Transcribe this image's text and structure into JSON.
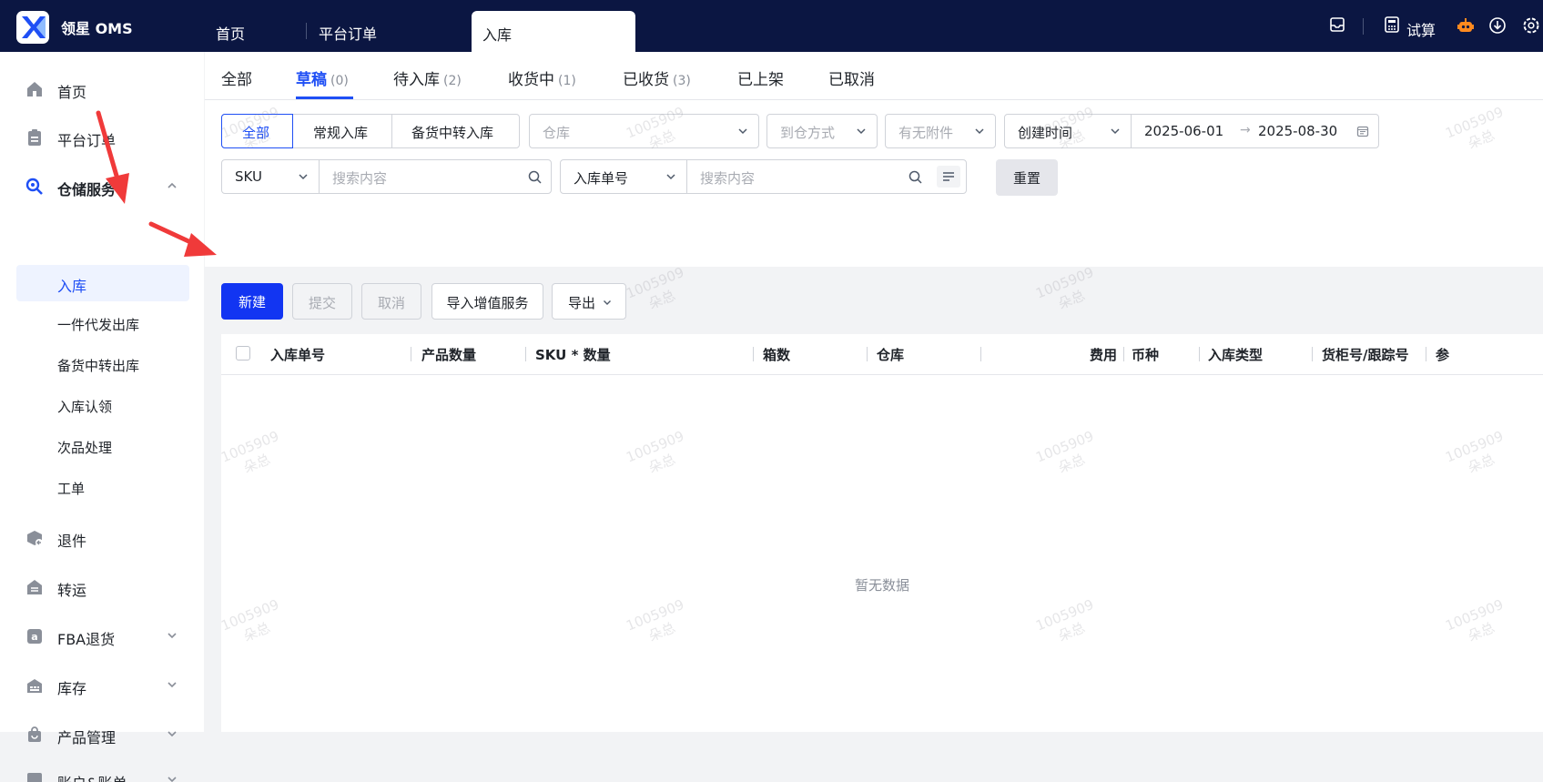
{
  "topbar": {
    "brand": "领星 OMS",
    "tabs": [
      "首页",
      "平台订单"
    ],
    "active_tab": "入库",
    "right_label": "试算"
  },
  "sidebar": {
    "home": "首页",
    "orders": "平台订单",
    "warehouse": "仓储服务",
    "sub": [
      "入库",
      "一件代发出库",
      "备货中转出库",
      "入库认领",
      "次品处理",
      "工单"
    ],
    "returns": "退件",
    "transfer": "转运",
    "fba": "FBA退货",
    "inventory": "库存",
    "products": "产品管理",
    "account": "账户&账单"
  },
  "status_tabs": [
    {
      "label": "全部",
      "count": ""
    },
    {
      "label": "草稿",
      "count": "(0)"
    },
    {
      "label": "待入库",
      "count": "(2)"
    },
    {
      "label": "收货中",
      "count": "(1)"
    },
    {
      "label": "已收货",
      "count": "(3)"
    },
    {
      "label": "已上架",
      "count": ""
    },
    {
      "label": "已取消",
      "count": ""
    }
  ],
  "filters": {
    "type_segments": [
      "全部",
      "常规入库",
      "备货中转入库"
    ],
    "warehouse_placeholder": "仓库",
    "arrival_placeholder": "到仓方式",
    "attachment_placeholder": "有无附件",
    "date_field": "创建时间",
    "date_start": "2025-06-01",
    "date_end": "2025-08-30",
    "sku_field": "SKU",
    "search_placeholder": "搜索内容",
    "order_field": "入库单号",
    "search_placeholder2": "搜索内容",
    "reset": "重置"
  },
  "actions": {
    "new": "新建",
    "submit": "提交",
    "cancel": "取消",
    "import": "导入增值服务",
    "export": "导出"
  },
  "table": {
    "columns": [
      "入库单号",
      "产品数量",
      "SKU * 数量",
      "箱数",
      "仓库",
      "费用",
      "币种",
      "入库类型",
      "货柜号/跟踪号",
      "参"
    ],
    "empty": "暂无数据"
  },
  "watermark": {
    "line1": "1005909",
    "line2": "朵总"
  },
  "colors": {
    "primary": "#1235f2",
    "topbar": "#0b1642",
    "annotation_arrow": "#f03a3a"
  }
}
